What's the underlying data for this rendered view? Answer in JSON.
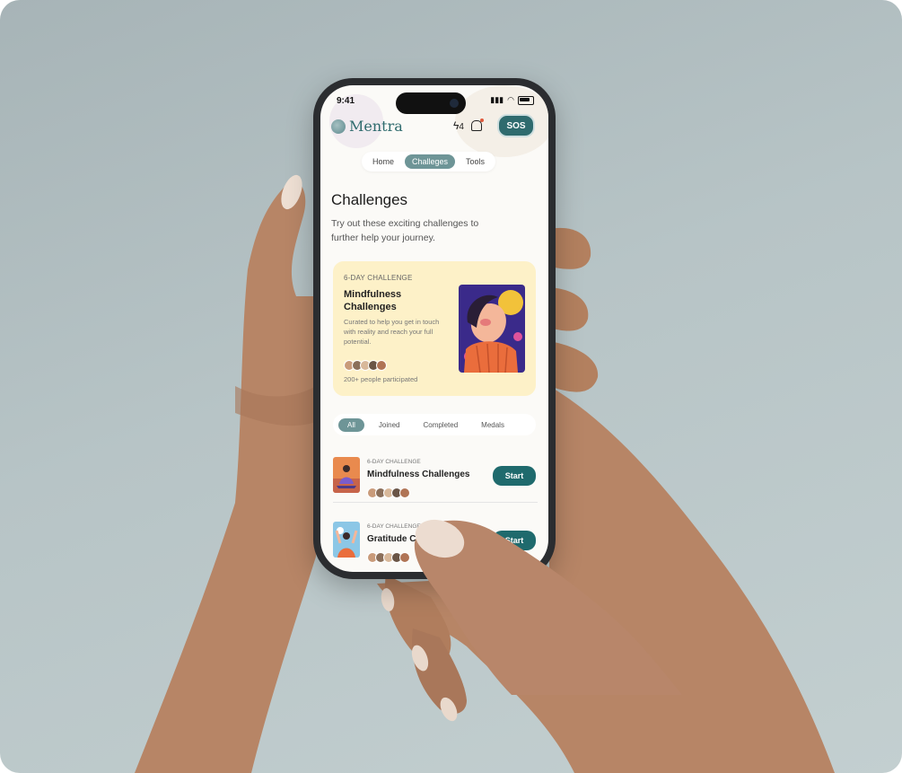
{
  "status_bar": {
    "time": "9:41"
  },
  "header": {
    "app_name": "Mentra",
    "energy_count": "4",
    "sos_label": "SOS"
  },
  "nav": {
    "tabs": [
      {
        "label": "Home"
      },
      {
        "label": "Challeges"
      },
      {
        "label": "Tools"
      }
    ],
    "active": "Challeges"
  },
  "page": {
    "title": "Challenges",
    "subtitle": "Try out these exciting challenges to further help your journey."
  },
  "featured": {
    "tag": "6-DAY CHALLENGE",
    "title": "Mindfulness Challenges",
    "description": "Curated to help you get in touch with reality and reach your full potential.",
    "participants": "200+ people participated"
  },
  "filters": {
    "items": [
      {
        "label": "All"
      },
      {
        "label": "Joined"
      },
      {
        "label": "Completed"
      },
      {
        "label": "Medals"
      }
    ],
    "active": "All"
  },
  "challenges": [
    {
      "tag": "6-DAY CHALLENGE",
      "name": "Mindfulness Challenges",
      "button": "Start"
    },
    {
      "tag": "6-DAY CHALLENGE",
      "name": "Gratitude Ch",
      "button": "Start"
    }
  ],
  "colors": {
    "accent": "#2f6b6e",
    "featured_bg": "#fdf1c8",
    "pill": "#6e9597"
  }
}
